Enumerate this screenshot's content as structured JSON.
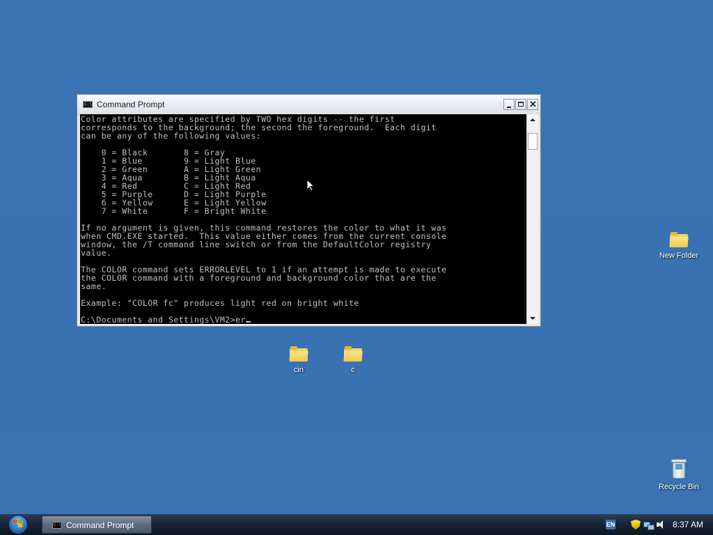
{
  "window": {
    "title": "Command Prompt",
    "console_lines": [
      "Color attributes are specified by TWO hex digits -- the first",
      "corresponds to the background; the second the foreground.  Each digit",
      "can be any of the following values:",
      "",
      "    0 = Black       8 = Gray",
      "    1 = Blue        9 = Light Blue",
      "    2 = Green       A = Light Green",
      "    3 = Aqua        B = Light Aqua",
      "    4 = Red         C = Light Red",
      "    5 = Purple      D = Light Purple",
      "    6 = Yellow      E = Light Yellow",
      "    7 = White       F = Bright White",
      "",
      "If no argument is given, this command restores the color to what it was",
      "when CMD.EXE started.  This value either comes from the current console",
      "window, the /T command line switch or from the DefaultColor registry",
      "value.",
      "",
      "The COLOR command sets ERRORLEVEL to 1 if an attempt is made to execute",
      "the COLOR command with a foreground and background color that are the",
      "same.",
      "",
      "Example: \"COLOR fc\" produces light red on bright white",
      ""
    ],
    "prompt": "C:\\Documents and Settings\\VM2>",
    "input": "er"
  },
  "desktop_icons": {
    "new_folder": "New Folder",
    "cin": "cin",
    "c": "c",
    "recycle_bin": "Recycle Bin"
  },
  "taskbar": {
    "task_label": "Command Prompt",
    "language": "EN",
    "clock": "8:37 AM"
  },
  "colors": {
    "desktop": "#3a73b3",
    "console_bg": "#000000",
    "console_fg": "#c0c0c0"
  }
}
